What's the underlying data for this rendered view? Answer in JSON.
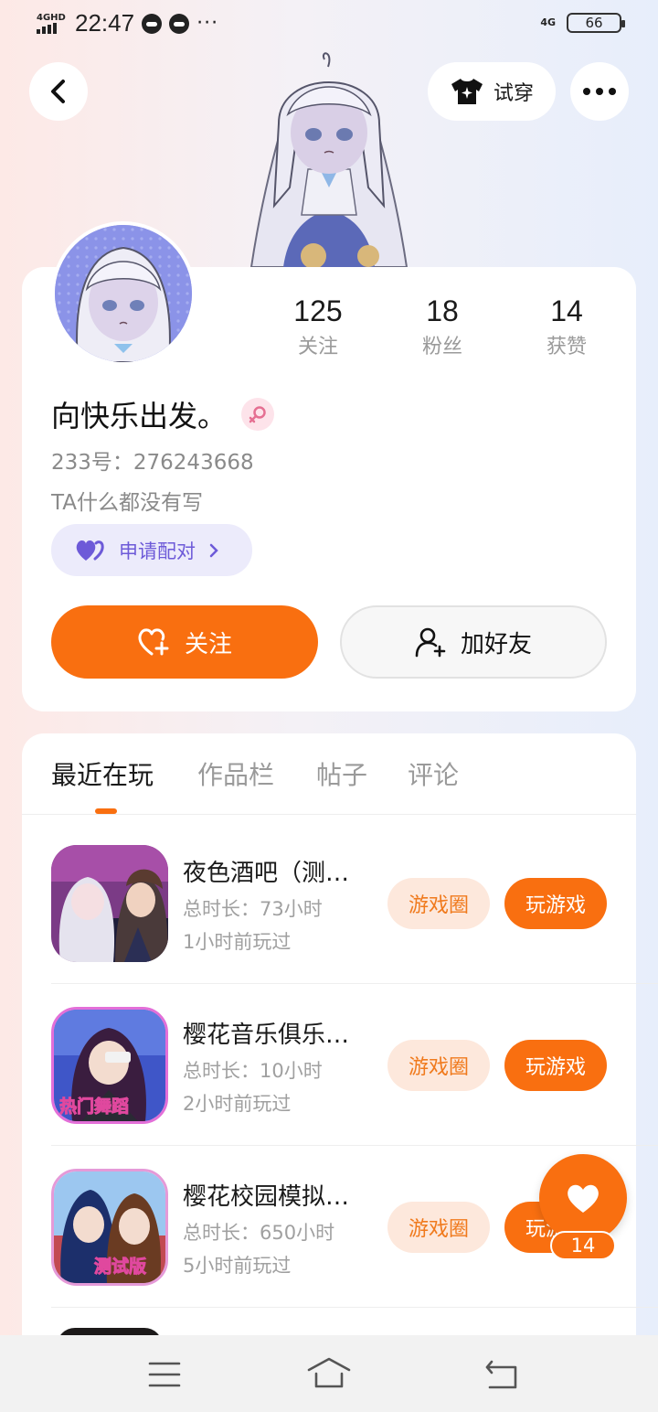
{
  "status_bar": {
    "network": "4GHD",
    "time": "22:47",
    "more": "···",
    "network_right": "4G",
    "battery": "66"
  },
  "header": {
    "back_icon": "chevron-left-icon",
    "try_on_label": "试穿",
    "try_on_icon": "tshirt-sparkle-icon",
    "more_icon": "more-dots-icon"
  },
  "profile": {
    "stats": [
      {
        "value": "125",
        "label": "关注"
      },
      {
        "value": "18",
        "label": "粉丝"
      },
      {
        "value": "14",
        "label": "获赞"
      }
    ],
    "nickname": "向快乐出发。",
    "gender_icon": "female-icon",
    "id_line": "233号：276243668",
    "bio": "TA什么都没有写",
    "pair_label": "申请配对",
    "follow_label": "关注",
    "add_friend_label": "加好友"
  },
  "tabs": [
    {
      "label": "最近在玩",
      "active": true
    },
    {
      "label": "作品栏",
      "active": false
    },
    {
      "label": "帖子",
      "active": false
    },
    {
      "label": "评论",
      "active": false
    }
  ],
  "games": [
    {
      "name": "夜色酒吧（测…",
      "duration": "总时长：73小时",
      "last_played": "1小时前玩过",
      "circle_label": "游戏圈",
      "play_label": "玩游戏"
    },
    {
      "name": "樱花音乐俱乐…",
      "duration": "总时长：10小时",
      "last_played": "2小时前玩过",
      "circle_label": "游戏圈",
      "play_label": "玩游戏",
      "badge": "热门舞蹈"
    },
    {
      "name": "樱花校园模拟…",
      "duration": "总时长：650小时",
      "last_played": "5小时前玩过",
      "circle_label": "游戏圈",
      "play_label": "玩游戏",
      "badge": "测试版"
    }
  ],
  "floating_like": {
    "count": "14",
    "icon": "heart-icon"
  },
  "colors": {
    "accent": "#f96f10",
    "pair_bg": "#ecebfb",
    "pair_text": "#6d5ad8"
  }
}
